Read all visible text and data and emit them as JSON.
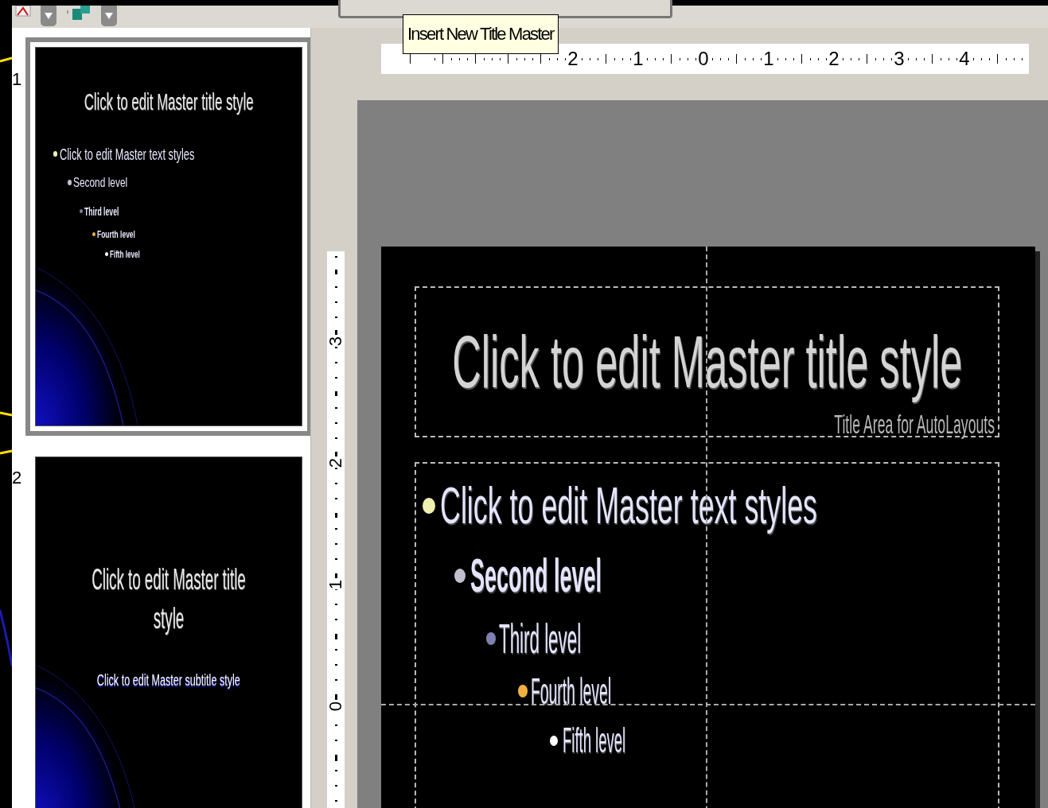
{
  "toolbar": {
    "tooltip": "Insert New Title Master"
  },
  "thumbnails": [
    {
      "number": "1",
      "selected": true,
      "kind": "master",
      "title": "Click to edit Master title style",
      "levels": [
        {
          "text": "Click to edit Master text styles",
          "color": "#f0f0b0"
        },
        {
          "text": "Second level",
          "color": "#c0c0d0"
        },
        {
          "text": "Third level",
          "color": "#8080b0"
        },
        {
          "text": "Fourth level",
          "color": "#f0b040"
        },
        {
          "text": "Fifth level",
          "color": "#ffffff"
        }
      ]
    },
    {
      "number": "2",
      "selected": false,
      "kind": "title_master",
      "title": "Click to edit Master title style",
      "subtitle": "Click to edit Master subtitle style"
    }
  ],
  "horizontal_ruler": [
    "2",
    "1",
    "0",
    "1",
    "2",
    "3",
    "4"
  ],
  "vertical_ruler": [
    "3",
    "2",
    "1",
    "0"
  ],
  "slide": {
    "title": "Click to edit Master title style",
    "title_area_label": "Title Area for AutoLayouts",
    "levels": [
      {
        "text": "Click to edit Master text styles",
        "color": "#f0f0b0"
      },
      {
        "text": "Second level",
        "color": "#c0c0d0"
      },
      {
        "text": "Third level",
        "color": "#8080b0"
      },
      {
        "text": "Fourth level",
        "color": "#f0b040"
      },
      {
        "text": "Fifth level",
        "color": "#ffffff"
      }
    ]
  }
}
